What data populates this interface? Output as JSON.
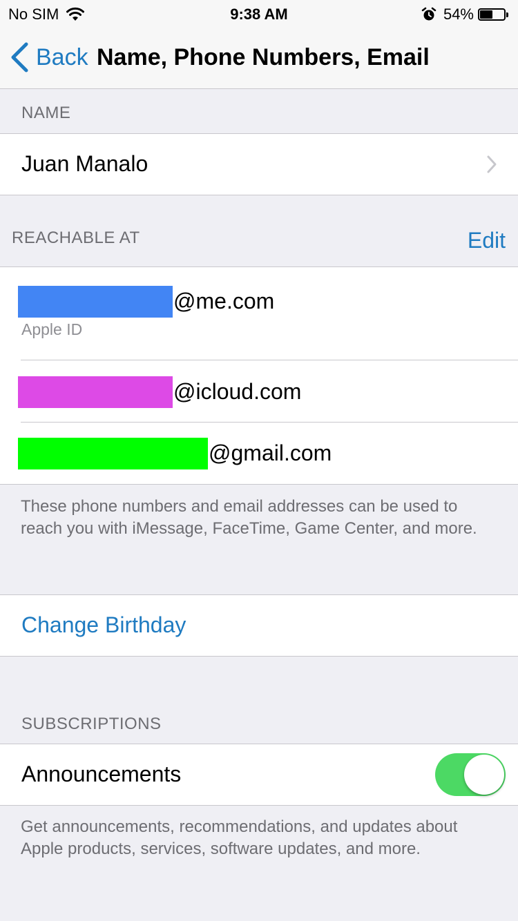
{
  "status_bar": {
    "carrier": "No SIM",
    "time": "9:38 AM",
    "battery_percent": "54%",
    "battery_level": 0.54
  },
  "nav": {
    "back_label": "Back",
    "title": "Name, Phone Numbers, Email"
  },
  "name_section": {
    "header": "NAME",
    "name": "Juan Manalo"
  },
  "reachable_section": {
    "header": "REACHABLE AT",
    "edit_label": "Edit",
    "items": [
      {
        "suffix": "@me.com",
        "sub_label": "Apple ID",
        "redact_color": "#4285f4"
      },
      {
        "suffix": "@icloud.com",
        "redact_color": "#dd4ae6"
      },
      {
        "suffix": "@gmail.com",
        "redact_color": "#00ff00"
      }
    ],
    "footer": "These phone numbers and email addresses can be used to reach you with iMessage, FaceTime, Game Center, and more."
  },
  "birthday": {
    "label": "Change Birthday"
  },
  "subscriptions_section": {
    "header": "SUBSCRIPTIONS",
    "announcements_label": "Announcements",
    "announcements_on": true,
    "footer": "Get announcements, recommendations, and updates about Apple products, services, software updates, and more."
  },
  "colors": {
    "accent": "#1f7bc1",
    "toggle_on": "#4cd964",
    "background": "#efeff4"
  }
}
